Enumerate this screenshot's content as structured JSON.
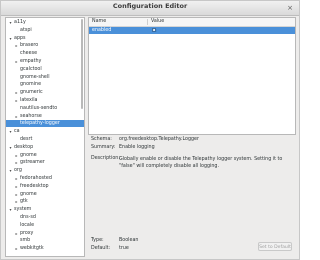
{
  "window": {
    "title": "Configuration Editor",
    "close_glyph": "×"
  },
  "tree": {
    "rows": [
      {
        "label": "a11y",
        "indent": 1,
        "toggle": "▾"
      },
      {
        "label": "atspi",
        "indent": 2,
        "toggle": ""
      },
      {
        "label": "apps",
        "indent": 1,
        "toggle": "▾"
      },
      {
        "label": "brasero",
        "indent": 2,
        "toggle": "▸"
      },
      {
        "label": "cheese",
        "indent": 2,
        "toggle": ""
      },
      {
        "label": "empathy",
        "indent": 2,
        "toggle": "▸"
      },
      {
        "label": "gcalctool",
        "indent": 2,
        "toggle": ""
      },
      {
        "label": "gnome-shell",
        "indent": 2,
        "toggle": ""
      },
      {
        "label": "gnomine",
        "indent": 2,
        "toggle": ""
      },
      {
        "label": "gnumeric",
        "indent": 2,
        "toggle": "▸"
      },
      {
        "label": "latexila",
        "indent": 2,
        "toggle": "▸"
      },
      {
        "label": "nautilus-sendto",
        "indent": 2,
        "toggle": ""
      },
      {
        "label": "seahorse",
        "indent": 2,
        "toggle": "▸"
      },
      {
        "label": "telepathy-logger",
        "indent": 2,
        "toggle": "",
        "selected": true
      },
      {
        "label": "ca",
        "indent": 1,
        "toggle": "▾"
      },
      {
        "label": "desrt",
        "indent": 2,
        "toggle": ""
      },
      {
        "label": "desktop",
        "indent": 1,
        "toggle": "▾"
      },
      {
        "label": "gnome",
        "indent": 2,
        "toggle": "▸"
      },
      {
        "label": "gstreamer",
        "indent": 2,
        "toggle": "▸"
      },
      {
        "label": "org",
        "indent": 1,
        "toggle": "▾"
      },
      {
        "label": "fedorahosted",
        "indent": 2,
        "toggle": "▸"
      },
      {
        "label": "freedesktop",
        "indent": 2,
        "toggle": "▸"
      },
      {
        "label": "gnome",
        "indent": 2,
        "toggle": "▸"
      },
      {
        "label": "gtk",
        "indent": 2,
        "toggle": "▸"
      },
      {
        "label": "system",
        "indent": 1,
        "toggle": "▾"
      },
      {
        "label": "dns-sd",
        "indent": 2,
        "toggle": ""
      },
      {
        "label": "locale",
        "indent": 2,
        "toggle": ""
      },
      {
        "label": "proxy",
        "indent": 2,
        "toggle": "▸"
      },
      {
        "label": "smb",
        "indent": 2,
        "toggle": ""
      },
      {
        "label": "webkitgtk",
        "indent": 2,
        "toggle": "▸"
      }
    ]
  },
  "keys": {
    "col_name": "Name",
    "col_value": "Value",
    "selected_name": "enabled",
    "selected_value": "☑",
    "selected_checked": true
  },
  "details": {
    "schema_label": "Schema:",
    "schema_value": "org.freedesktop.Telepathy.Logger",
    "summary_label": "Summary:",
    "summary_value": "Enable logging",
    "description_label": "Description:",
    "description_value": "Globally enable or disable the Telepathy logger system. Setting it to \"false\" will completely disable all logging.",
    "type_label": "Type:",
    "type_value": "Boolean",
    "default_label": "Default:",
    "default_value": "true",
    "set_default_label": "Set to Default"
  }
}
